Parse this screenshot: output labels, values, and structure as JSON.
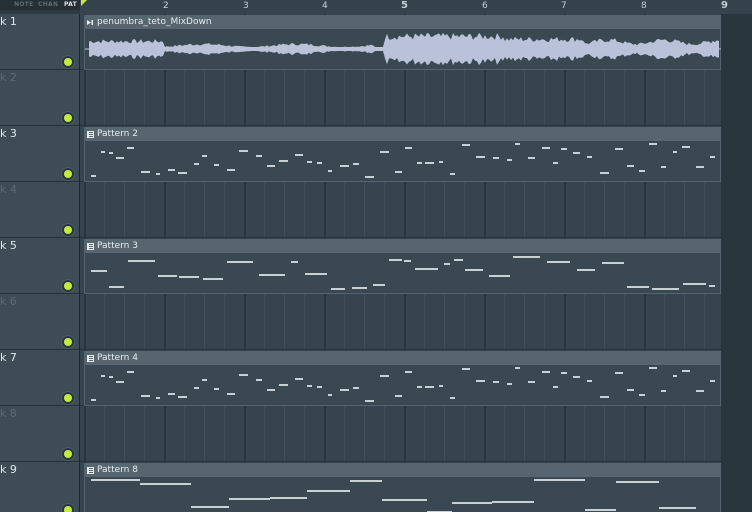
{
  "mode_buttons": [
    {
      "label": "NOTE",
      "active": false
    },
    {
      "label": "CHAN",
      "active": false
    },
    {
      "label": "PAT",
      "active": true
    }
  ],
  "ruler": {
    "bars": [
      "2",
      "3",
      "4",
      "5",
      "6",
      "7",
      "8",
      "9"
    ]
  },
  "tracks": [
    {
      "label": "k 1",
      "active": true
    },
    {
      "label": "k 2",
      "active": false
    },
    {
      "label": "k 3",
      "active": true
    },
    {
      "label": "k 4",
      "active": false
    },
    {
      "label": "k 5",
      "active": true
    },
    {
      "label": "k 6",
      "active": false
    },
    {
      "label": "k 7",
      "active": true
    },
    {
      "label": "k 8",
      "active": false
    },
    {
      "label": "k 9",
      "active": true
    }
  ],
  "clips": {
    "audio": {
      "title": "penumbra_teto_MixDown",
      "icon": "audio-clip-icon"
    },
    "pattern2": {
      "title": "Pattern 2",
      "icon": "pattern-icon"
    },
    "pattern3": {
      "title": "Pattern 3",
      "icon": "pattern-icon"
    },
    "pattern4": {
      "title": "Pattern 4",
      "icon": "pattern-icon"
    },
    "pattern8": {
      "title": "Pattern 8",
      "icon": "pattern-icon"
    }
  },
  "colors": {
    "accent_led": "#c5ee3c",
    "clip_header": "#56656e",
    "waveform": "#b9c2d8"
  }
}
